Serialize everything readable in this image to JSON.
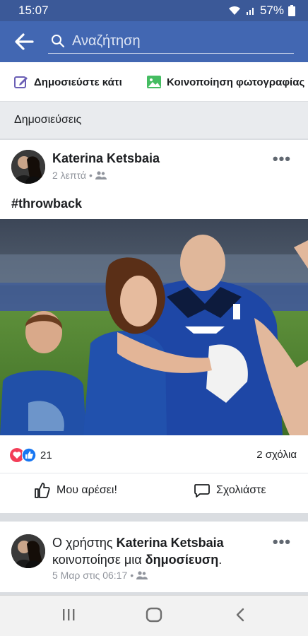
{
  "status": {
    "time": "15:07",
    "battery": "57%"
  },
  "search": {
    "placeholder": "Αναζήτηση"
  },
  "actions": {
    "post_label": "Δημοσιεύστε κάτι",
    "photo_label": "Κοινοποίηση φωτογραφίας"
  },
  "section": {
    "title": "Δημοσιεύσεις"
  },
  "post": {
    "author": "Katerina Ketsbaia",
    "time": "2 λεπτά",
    "separator": "•",
    "text": "#throwback",
    "reaction_count": "21",
    "comments": "2 σχόλια",
    "like_label": "Μου αρέσει!",
    "comment_label": "Σχολιάστε",
    "more": "•••"
  },
  "post2": {
    "prefix": "Ο χρήστης ",
    "author": "Katerina Ketsbaia",
    "middle": "κοινοποίησε μια ",
    "link": "δημοσίευση",
    "suffix": ".",
    "time": "5 Μαρ στις 06:17",
    "separator": "•",
    "more": "•••"
  },
  "colors": {
    "header": "#4267b2",
    "statusbar": "#3b5998",
    "like_blue": "#1877f2",
    "love_red": "#f33e58"
  },
  "icons": [
    "signal-icon",
    "wifi-icon",
    "battery-icon",
    "back-arrow-icon",
    "search-icon",
    "edit-icon",
    "photo-icon",
    "friends-icon",
    "more-icon",
    "love-reaction-icon",
    "like-reaction-icon",
    "like-icon",
    "comment-icon",
    "recent-apps-icon",
    "home-icon",
    "back-nav-icon"
  ]
}
